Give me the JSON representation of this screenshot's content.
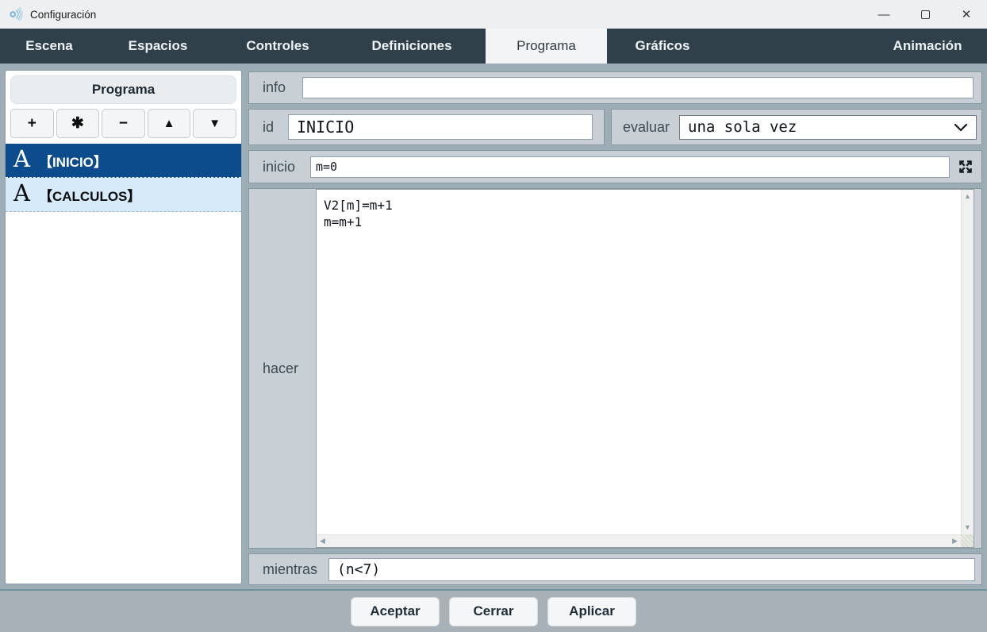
{
  "window": {
    "title": "Configuración",
    "controls": {
      "minimize": "—",
      "close": "✕"
    }
  },
  "tabs": [
    {
      "label": "Escena",
      "selected": false
    },
    {
      "label": "Espacios",
      "selected": false
    },
    {
      "label": "Controles",
      "selected": false
    },
    {
      "label": "Definiciones",
      "selected": false
    },
    {
      "label": "Programa",
      "selected": true
    },
    {
      "label": "Gráficos",
      "selected": false
    },
    {
      "label": "Animación",
      "selected": false
    }
  ],
  "left_panel": {
    "header": "Programa",
    "toolbar": [
      {
        "name": "add",
        "glyph": "+"
      },
      {
        "name": "duplicate",
        "glyph": "✱"
      },
      {
        "name": "remove",
        "glyph": "−"
      },
      {
        "name": "move-up",
        "glyph": "▲"
      },
      {
        "name": "move-down",
        "glyph": "▼"
      }
    ],
    "items": [
      {
        "glyph": "A",
        "label": "【INICIO】",
        "selected": true
      },
      {
        "glyph": "A",
        "label": "【CALCULOS】",
        "selected": false
      }
    ]
  },
  "form": {
    "info": {
      "label": "info",
      "value": ""
    },
    "id": {
      "label": "id",
      "value": "INICIO"
    },
    "evaluar": {
      "label": "evaluar",
      "value": "una sola vez"
    },
    "inicio": {
      "label": "inicio",
      "value": "m=0"
    },
    "hacer": {
      "label": "hacer",
      "code": "V2[m]=m+1\nm=m+1"
    },
    "mientras": {
      "label": "mientras",
      "value": "(n<7)"
    }
  },
  "scrollbars": {
    "up": "▲",
    "down": "▼",
    "left": "◀",
    "right": "▶"
  },
  "footer": {
    "buttons": [
      "Aceptar",
      "Cerrar",
      "Aplicar"
    ]
  },
  "colors": {
    "accent_selected": "#0d4c8c",
    "item_alt": "#d7eafa",
    "tabbar": "#30404a",
    "row_bg": "#c9d0d5",
    "main_bg": "#9dadb6"
  }
}
